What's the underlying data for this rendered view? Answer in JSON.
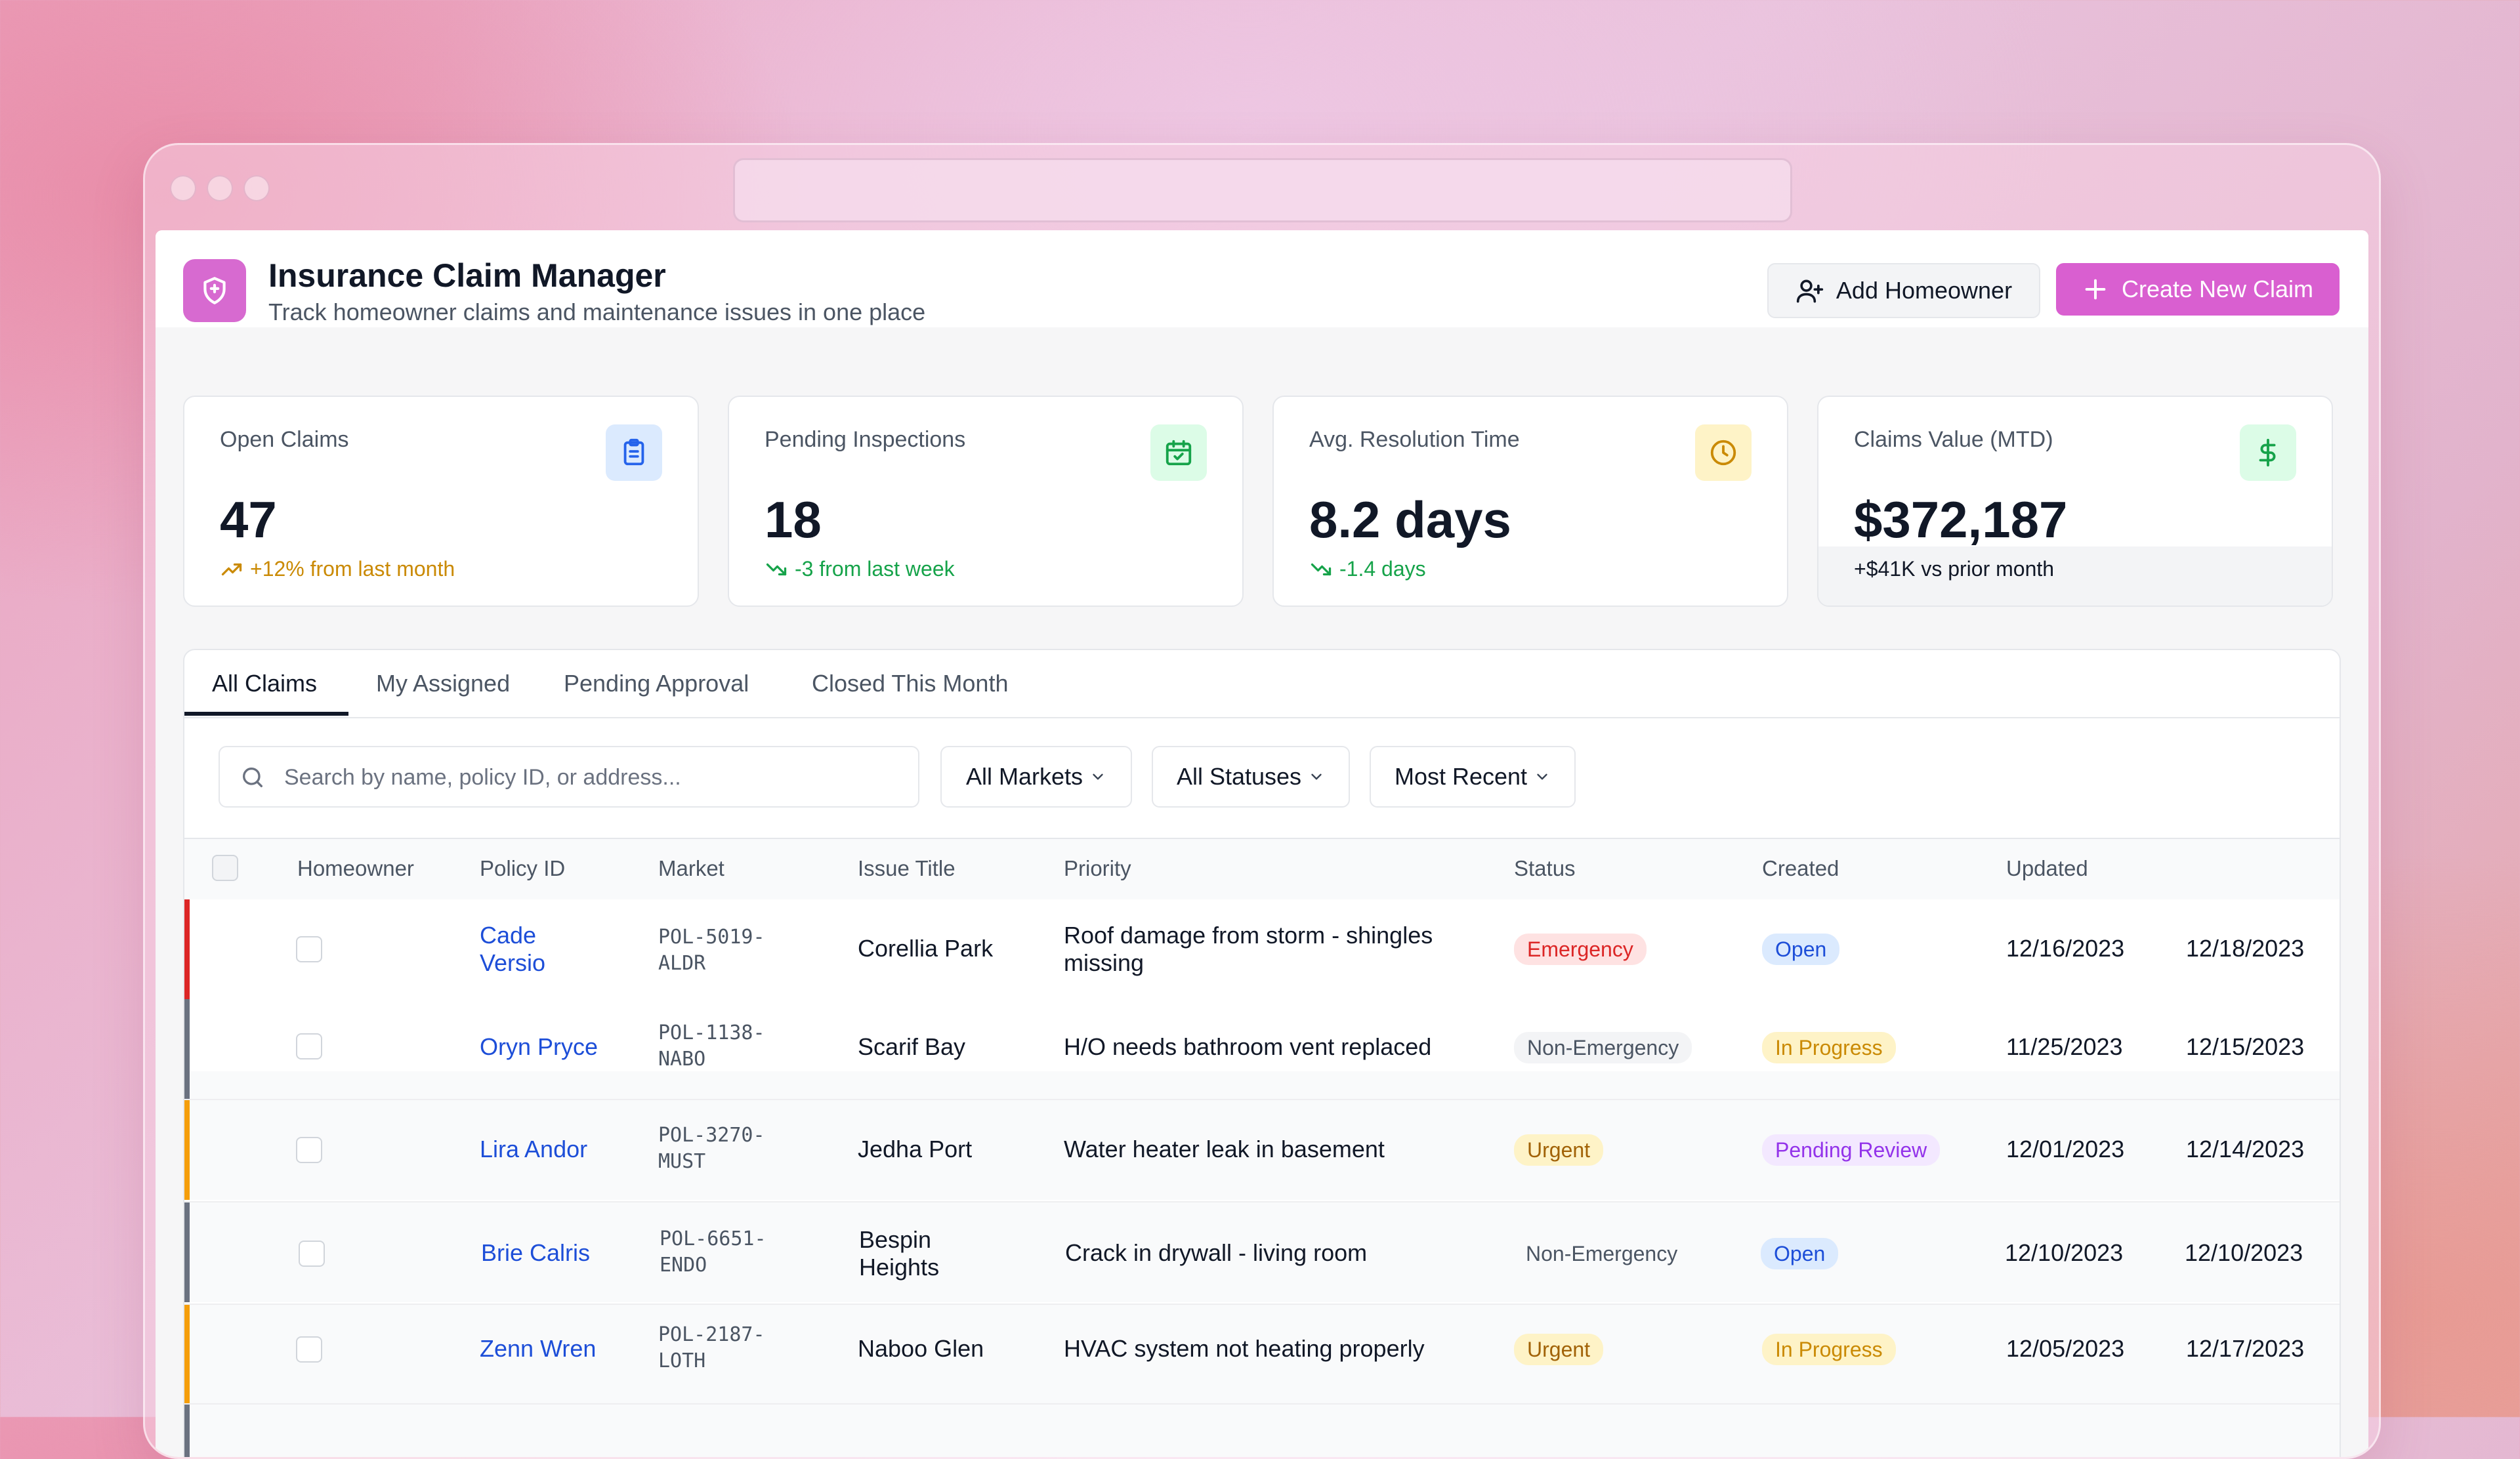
{
  "header": {
    "title": "Insurance Claim Manager",
    "subtitle": "Track homeowner claims and maintenance issues in one place",
    "add_homeowner": "Add Homeowner",
    "create_claim": "Create New Claim"
  },
  "stats": [
    {
      "label": "Open Claims",
      "value": "47",
      "trend": "+12% from last month",
      "trend_color": "#ca8a04",
      "icon": "clipboard-icon"
    },
    {
      "label": "Pending Inspections",
      "value": "18",
      "trend": "-3 from last week",
      "trend_color": "#16a34a",
      "icon": "calendar-check-icon"
    },
    {
      "label": "Avg. Resolution Time",
      "value": "8.2 days",
      "trend": "-1.4 days",
      "trend_color": "#16a34a",
      "icon": "clock-icon"
    },
    {
      "label": "Claims Value (MTD)",
      "value": "$372,187",
      "trend": "+$41K vs prior month",
      "trend_color": "#111827",
      "icon": "dollar-icon"
    }
  ],
  "tabs": [
    "All Claims",
    "My Assigned",
    "Pending Approval",
    "Closed This Month"
  ],
  "filters": {
    "search_placeholder": "Search by name, policy ID, or address...",
    "market": "All Markets",
    "status": "All Statuses",
    "sort": "Most Recent"
  },
  "columns": [
    "Homeowner",
    "Policy ID",
    "Market",
    "Issue Title",
    "Priority",
    "Status",
    "Created",
    "Updated"
  ],
  "rows": [
    {
      "name_line1": "Cade",
      "name_line2": "Versio",
      "policy_line1": "POL-5019-",
      "policy_line2": "ALDR",
      "market": "Corellia Park",
      "issue_line1": "Roof damage from storm - shingles",
      "issue_line2": "missing",
      "priority": "Emergency",
      "status": "Open",
      "created": "12/16/2023",
      "updated": "12/18/2023",
      "stripe": "#dc2626"
    },
    {
      "name": "Oryn Pryce",
      "policy_line1": "POL-1138-",
      "policy_line2": "NABO",
      "market": "Scarif Bay",
      "issue": "H/O needs bathroom vent replaced",
      "priority": "Non-Emergency",
      "status": "In Progress",
      "created": "11/25/2023",
      "updated": "12/15/2023",
      "stripe": "#6b7280"
    },
    {
      "name": "Lira Andor",
      "policy_line1": "POL-3270-",
      "policy_line2": "MUST",
      "market": "Jedha Port",
      "issue": "Water heater leak in basement",
      "priority": "Urgent",
      "status": "Pending Review",
      "created": "12/01/2023",
      "updated": "12/14/2023",
      "stripe": "#f59e0b"
    },
    {
      "name": "Brie Calris",
      "policy_line1": "POL-6651-",
      "policy_line2": "ENDO",
      "market_line1": "Bespin",
      "market_line2": "Heights",
      "issue": "Crack in drywall - living room",
      "priority": "Non-Emergency",
      "status": "Open",
      "created": "12/10/2023",
      "updated": "12/10/2023",
      "stripe": "#6b7280"
    },
    {
      "name": "Zenn Wren",
      "policy_line1": "POL-2187-",
      "policy_line2": "LOTH",
      "market": "Naboo Glen",
      "issue": "HVAC system not heating properly",
      "priority": "Urgent",
      "status": "In Progress",
      "created": "12/05/2023",
      "updated": "12/17/2023",
      "stripe": "#f59e0b"
    }
  ]
}
